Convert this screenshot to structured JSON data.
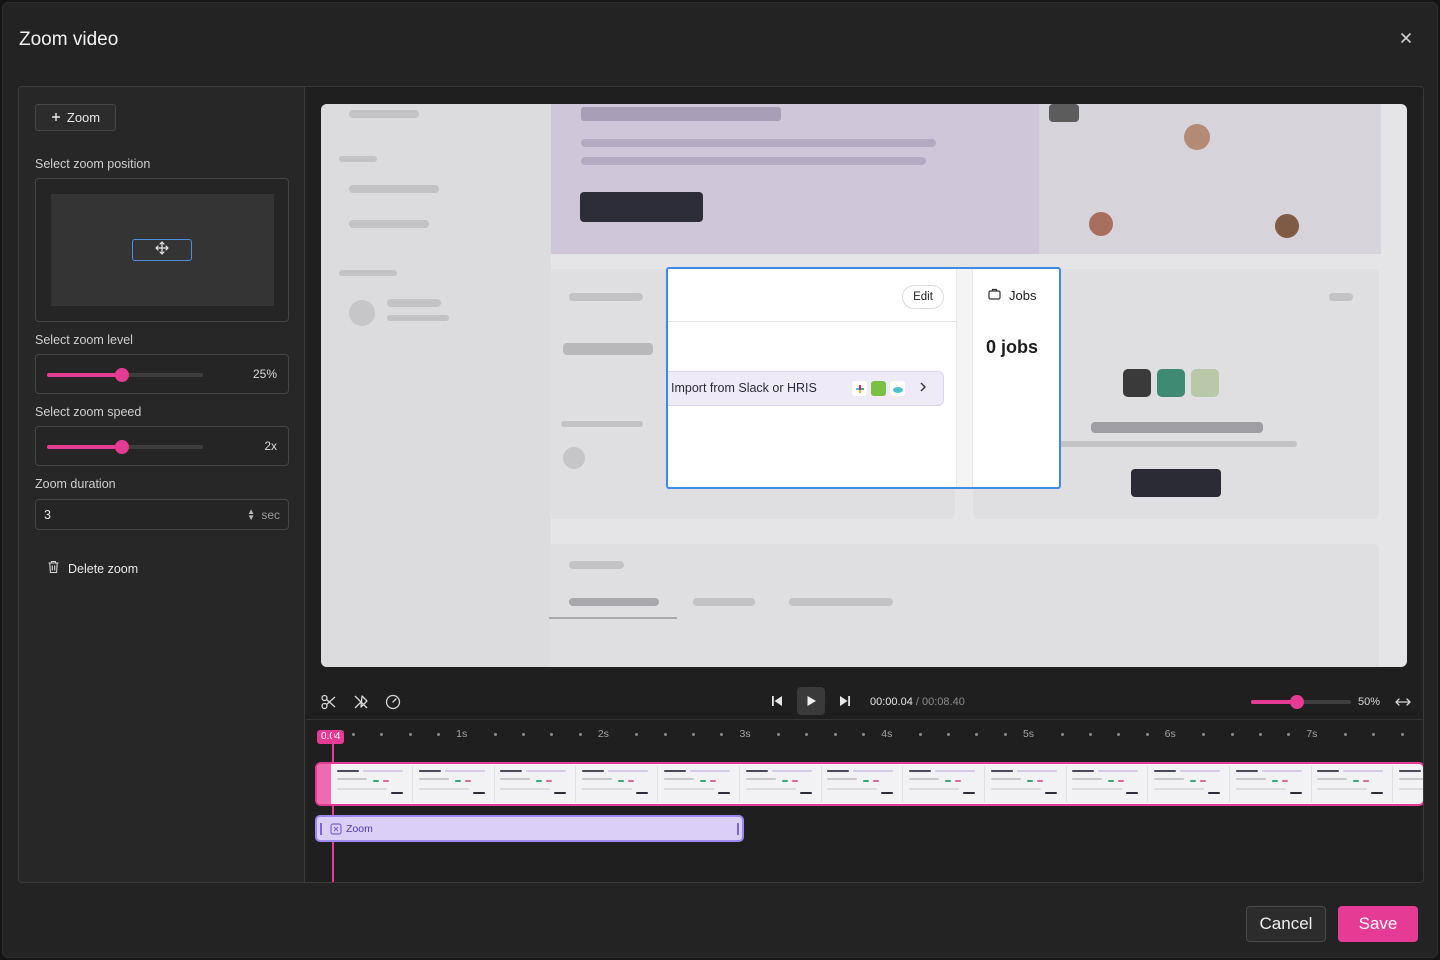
{
  "dialog": {
    "title": "Zoom video",
    "close_icon": "close-icon"
  },
  "sidebar": {
    "add_zoom_label": "Zoom",
    "zoom_position_label": "Select zoom position",
    "zoom_level_label": "Select zoom level",
    "zoom_level_value": "25%",
    "zoom_level_fraction": 0.48,
    "zoom_speed_label": "Select zoom speed",
    "zoom_speed_value": "2x",
    "zoom_speed_fraction": 0.48,
    "zoom_duration_label": "Zoom duration",
    "zoom_duration_value": "3",
    "zoom_duration_unit": "sec",
    "delete_zoom_label": "Delete zoom"
  },
  "preview": {
    "edit_label": "Edit",
    "jobs_title": "Jobs",
    "jobs_count": "0 jobs",
    "slack_text": "Import from Slack or HRIS"
  },
  "player": {
    "current_time": "00:00.04",
    "separator": " / ",
    "total_time": "00:08.40",
    "timeline_zoom_value": "50%",
    "timeline_zoom_fraction": 0.46
  },
  "timeline": {
    "playhead_label": "0.04",
    "second_labels": [
      "1s",
      "2s",
      "3s",
      "4s",
      "5s",
      "6s",
      "7s"
    ],
    "zoom_segment_label": "Zoom"
  },
  "footer": {
    "cancel_label": "Cancel",
    "save_label": "Save"
  },
  "colors": {
    "accent": "#e53b95",
    "selection_blue": "#3d8be6",
    "zoom_segment": "#dccff7"
  }
}
